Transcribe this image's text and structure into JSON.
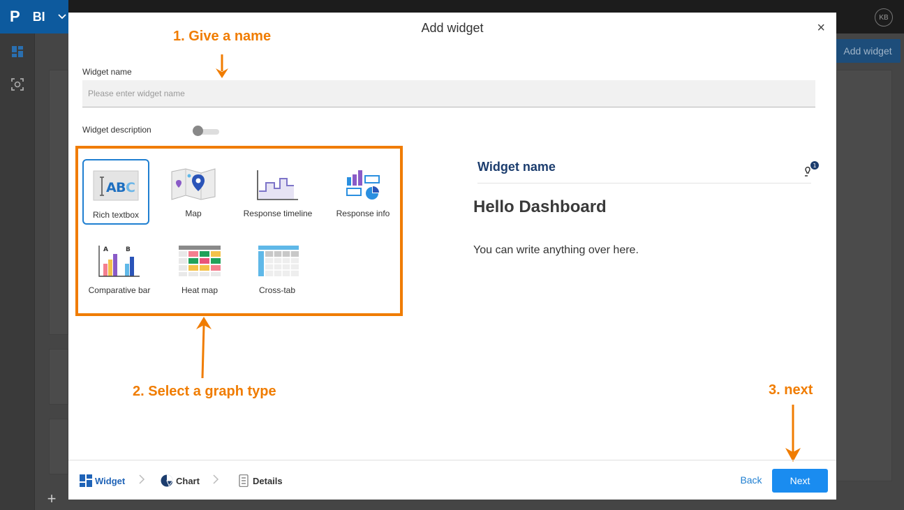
{
  "app": {
    "logo": "P",
    "product": "BI",
    "user_initials": "KB",
    "add_widget_label": "Add widget"
  },
  "modal": {
    "title": "Add widget",
    "close_glyph": "×",
    "widget_name_label": "Widget name",
    "widget_name_placeholder": "Please enter widget name",
    "widget_name_value": "",
    "widget_description_label": "Widget description",
    "widget_description_enabled": false
  },
  "widget_types": [
    {
      "label": "Rich textbox",
      "icon": "rich-textbox-icon",
      "selected": true
    },
    {
      "label": "Map",
      "icon": "map-icon",
      "selected": false
    },
    {
      "label": "Response timeline",
      "icon": "response-timeline-icon",
      "selected": false
    },
    {
      "label": "Response info",
      "icon": "response-info-icon",
      "selected": false
    },
    {
      "label": "Comparative bar",
      "icon": "comparative-bar-icon",
      "selected": false
    },
    {
      "label": "Heat map",
      "icon": "heat-map-icon",
      "selected": false
    },
    {
      "label": "Cross-tab",
      "icon": "cross-tab-icon",
      "selected": false
    }
  ],
  "preview": {
    "title": "Widget name",
    "badge_count": "1",
    "heading": "Hello Dashboard",
    "body": "You can write anything over here."
  },
  "footer": {
    "steps": [
      {
        "label": "Widget",
        "active": true
      },
      {
        "label": "Chart",
        "active": false
      },
      {
        "label": "Details",
        "active": false
      }
    ],
    "back_label": "Back",
    "next_label": "Next"
  },
  "annotations": {
    "step1": "1. Give a name",
    "step2": "2. Select a graph type",
    "step3": "3. next",
    "color": "#f07c00"
  },
  "colors": {
    "accent": "#1a8cf0",
    "brand": "#0d5a9e",
    "annotation": "#f07c00",
    "preview_title": "#1c3d6e"
  }
}
